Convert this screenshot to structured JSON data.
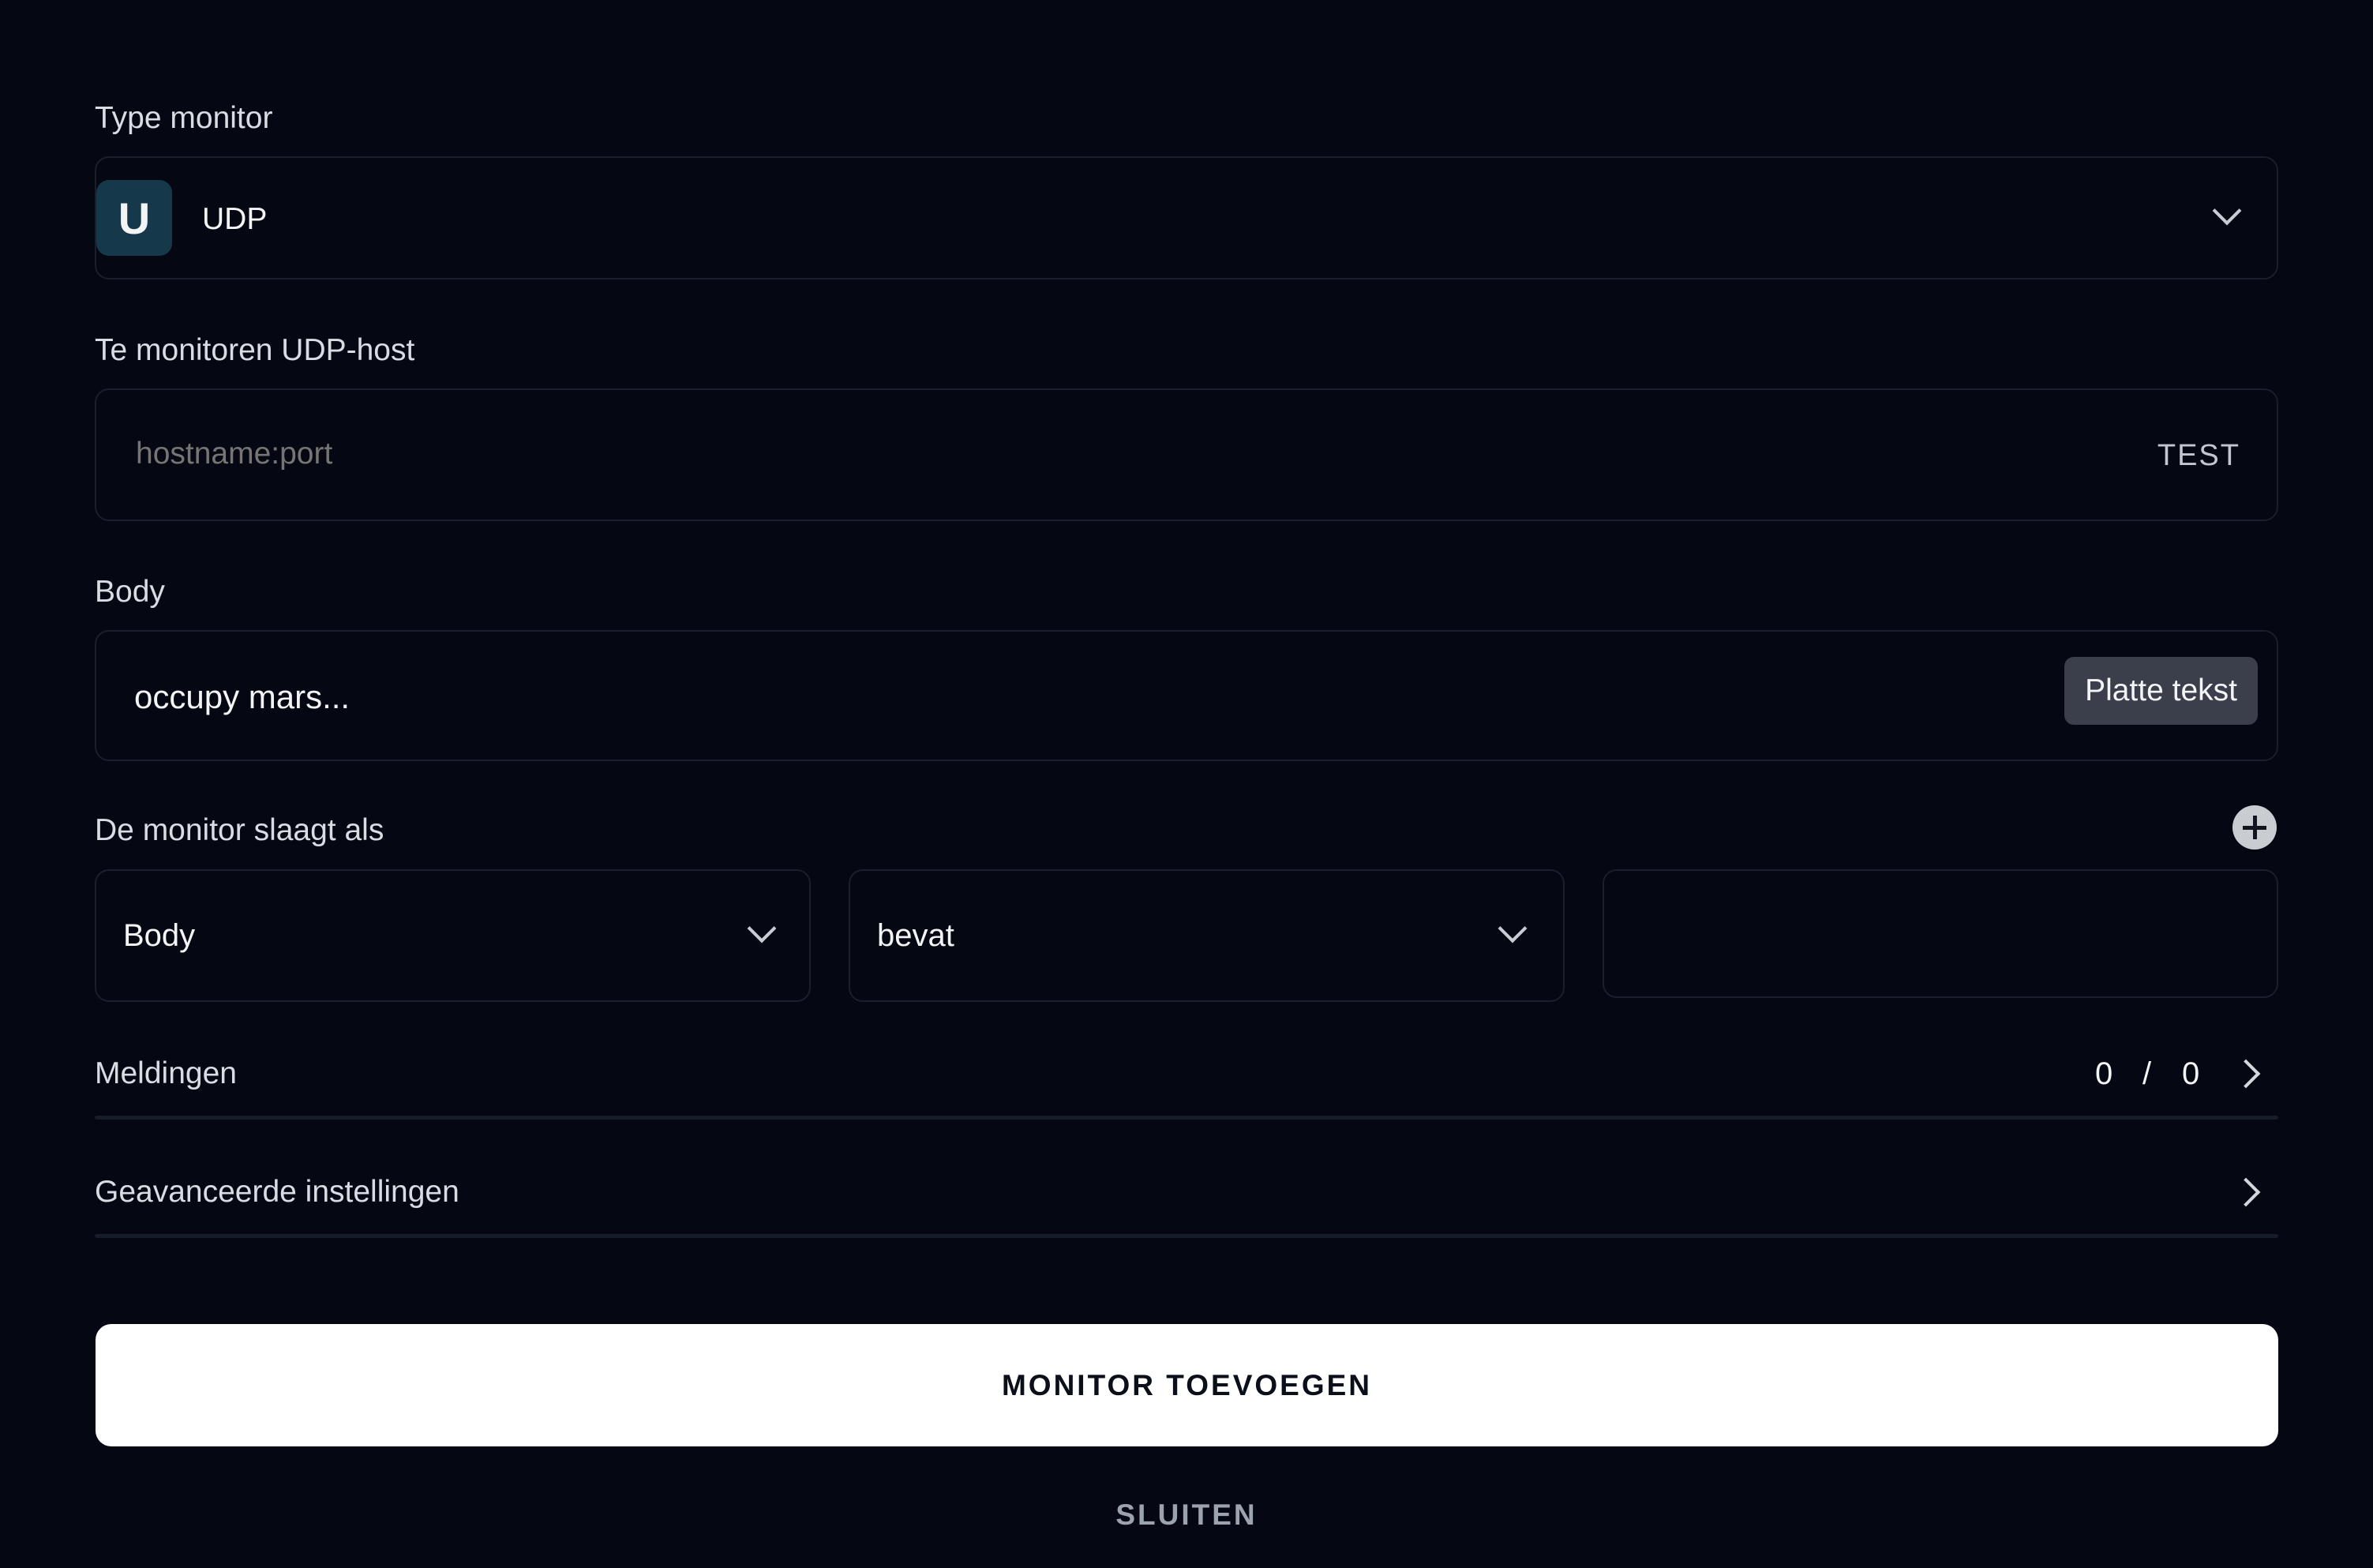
{
  "type_monitor": {
    "label": "Type monitor",
    "icon_letter": "U",
    "selected": "UDP",
    "colors": {
      "icon_bg": "#15384a"
    }
  },
  "host": {
    "label": "Te monitoren UDP-host",
    "placeholder": "hostname:port",
    "test_label": "TEST"
  },
  "body": {
    "label": "Body",
    "value": "occupy mars...",
    "format_label": "Platte tekst"
  },
  "condition": {
    "label": "De monitor slaagt als",
    "field": "Body",
    "operator": "bevat",
    "value": ""
  },
  "notifications": {
    "label": "Meldingen",
    "count_active": "0",
    "separator": "/",
    "count_total": "0"
  },
  "advanced": {
    "label": "Geavanceerde instellingen"
  },
  "actions": {
    "submit_label": "MONITOR TOEVOEGEN",
    "close_label": "SLUITEN"
  }
}
